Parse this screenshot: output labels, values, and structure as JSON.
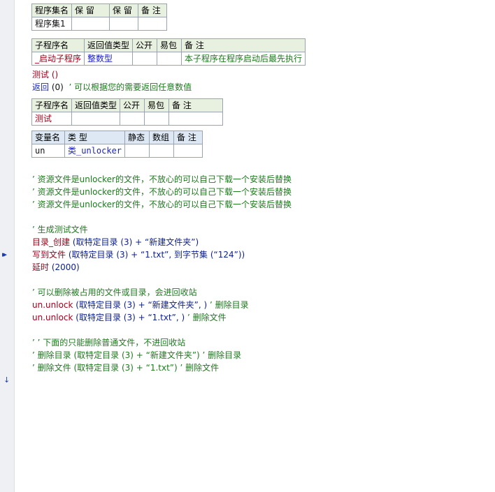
{
  "program_set_table": {
    "headers": [
      "程序集名",
      "保 留",
      "保 留",
      "备 注"
    ],
    "row": [
      "程序集1",
      "",
      "",
      ""
    ]
  },
  "startup_sub_table": {
    "headers": [
      "子程序名",
      "返回值类型",
      "公开",
      "易包",
      "备 注"
    ],
    "row": [
      "_启动子程序",
      "整数型",
      "",
      "",
      "本子程序在程序启动后最先执行"
    ]
  },
  "startup_body": {
    "call_test": "测试 ()",
    "return_kw": "返回",
    "return_args": " (0)  ",
    "return_comment": "’ 可以根据您的需要返回任意数值"
  },
  "test_sub_table": {
    "headers": [
      "子程序名",
      "返回值类型",
      "公开",
      "易包",
      "备 注"
    ],
    "row": [
      "测试",
      "",
      "",
      "",
      ""
    ]
  },
  "var_table": {
    "headers": [
      "变量名",
      "类 型",
      "静态",
      "数组",
      "备 注"
    ],
    "row": [
      "un",
      "类_unlocker",
      "",
      "",
      ""
    ]
  },
  "code": {
    "comment_resource_1": "’ 资源文件是unlocker的文件，不放心的可以自己下载一个安装后替换",
    "comment_resource_2": "’ 资源文件是unlocker的文件，不放心的可以自己下载一个安装后替换",
    "comment_resource_3": "’ 资源文件是unlocker的文件，不放心的可以自己下载一个安装后替换",
    "comment_gen": "’ 生成测试文件",
    "mkdir_fn": "目录_创建",
    "mkdir_args": " (取特定目录 (3) + “新建文件夹”)",
    "write_fn": "写到文件",
    "write_args": " (取特定目录 (3) + “1.txt”, 到字节集 (“124”))",
    "delay_fn": "延时",
    "delay_args": " (2000)",
    "comment_occupied": "’ 可以删除被占用的文件或目录，会进回收站",
    "unlock1_obj": "un.unlock",
    "unlock1_args": " (取特定目录 (3) + “新建文件夹”, ) ",
    "unlock1_comment": "’ 删除目录",
    "unlock2_obj": "un.unlock",
    "unlock2_args": " (取特定目录 (3) + “1.txt”, ) ",
    "unlock2_comment": "’ 删除文件",
    "comment_normal": "’ ’ 下面的只能删除普通文件，不进回收站",
    "comment_rmdir": "’ 删除目录 (取特定目录 (3) + “新建文件夹”) ’ 删除目录",
    "comment_rmfile": "’ 删除文件 (取特定目录 (3) + “1.txt”) ’ 删除文件"
  },
  "colors": {
    "comment": "#1d7a1d",
    "keyword": "#1f2bb5",
    "function": "#a3001a",
    "gutter": "#eef0f4"
  }
}
